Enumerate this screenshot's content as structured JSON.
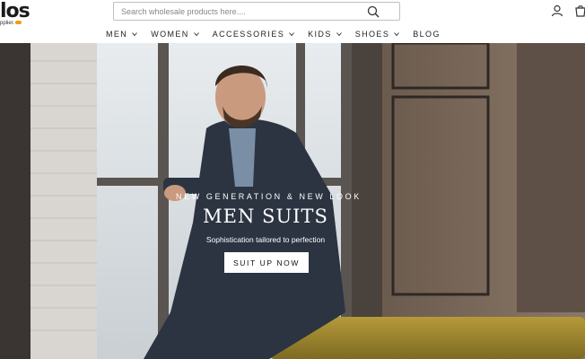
{
  "header": {
    "logo_main": "los",
    "logo_sub": "pplier.",
    "search_placeholder": "Search wholesale products here....",
    "icons": [
      "search-icon",
      "user-icon",
      "cart-icon"
    ]
  },
  "nav": {
    "items": [
      {
        "label": "MEN",
        "has_dropdown": true
      },
      {
        "label": "WOMEN",
        "has_dropdown": true
      },
      {
        "label": "ACCESSORIES",
        "has_dropdown": true
      },
      {
        "label": "KIDS",
        "has_dropdown": true
      },
      {
        "label": "SHOES",
        "has_dropdown": true
      },
      {
        "label": "BLOG",
        "has_dropdown": false
      }
    ]
  },
  "hero": {
    "eyebrow": "NEW GENERATION & NEW LOOK",
    "headline": "MEN SUITS",
    "subline": "Sophistication tailored to perfection",
    "cta_label": "SUIT UP NOW"
  },
  "colors": {
    "accent_logo": "#f39c12",
    "text": "#222222",
    "hero_text": "#ffffff"
  }
}
